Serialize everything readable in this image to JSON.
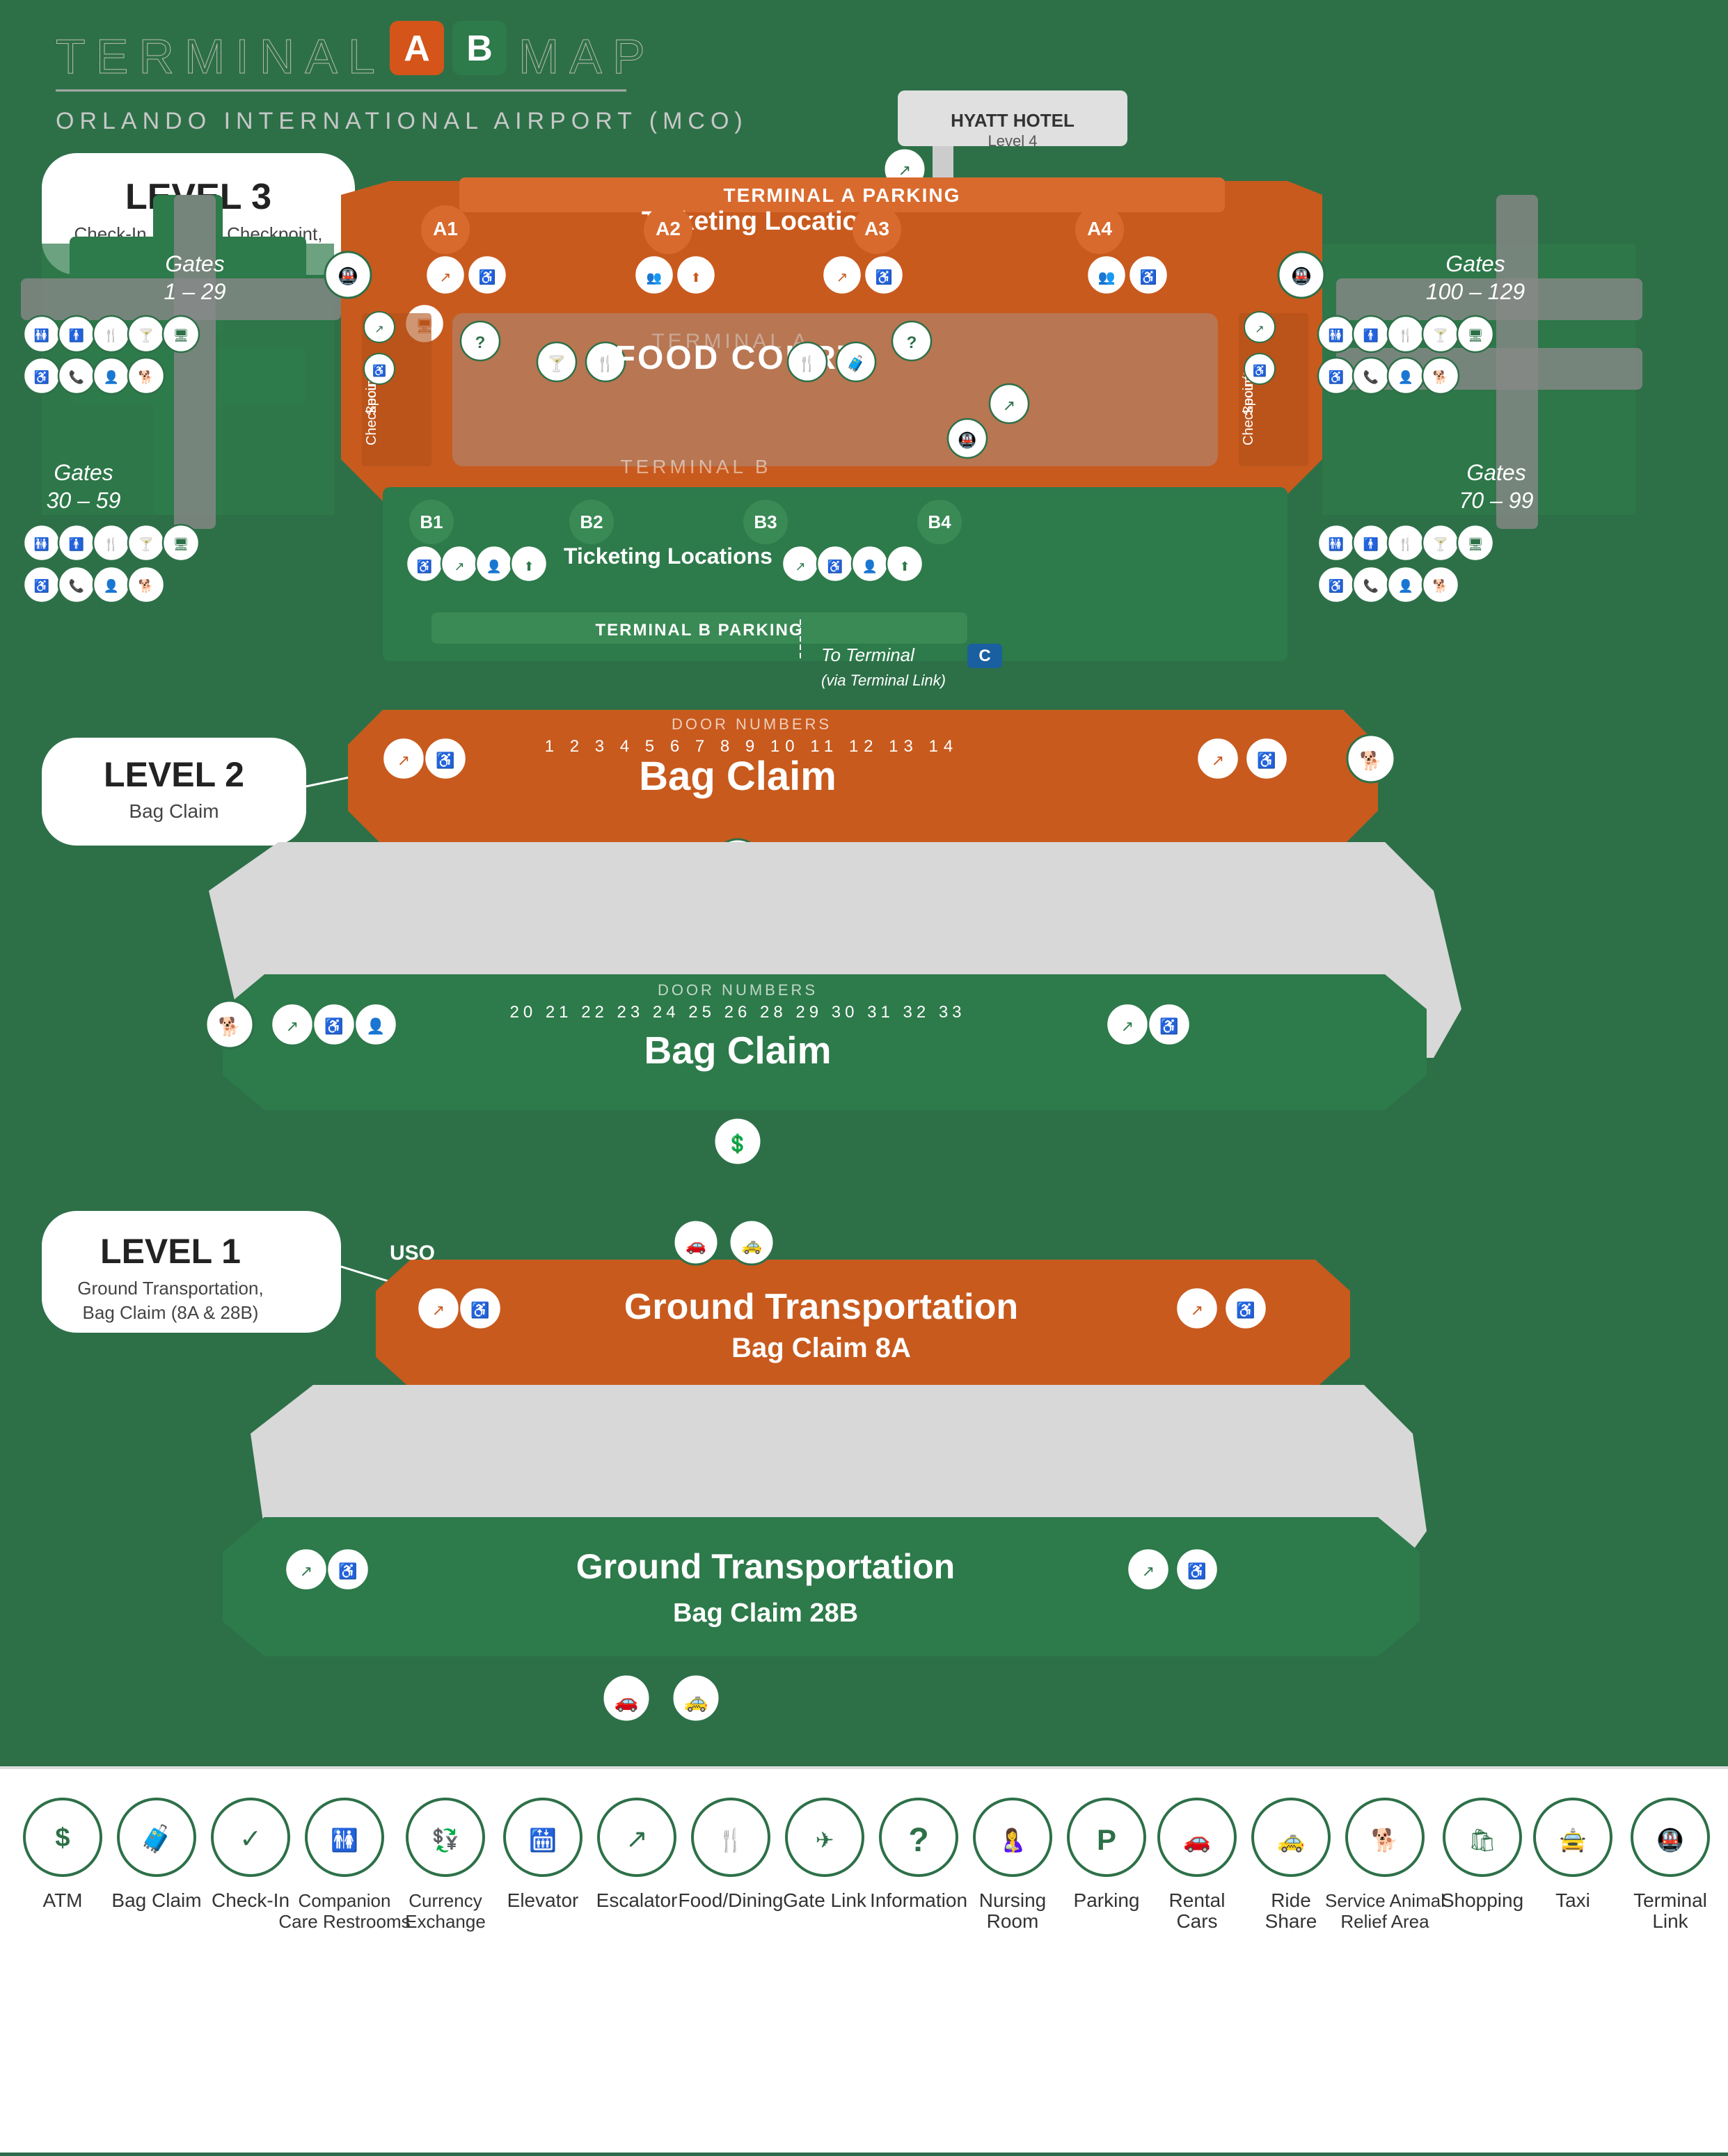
{
  "title": {
    "prefix": "TERMINAL",
    "badge_a": "A",
    "badge_b": "B",
    "suffix": "MAP",
    "airport": "ORLANDO INTERNATIONAL AIRPORT (MCO)"
  },
  "levels": {
    "level3": {
      "number": "LEVEL 3",
      "description": "Check-In, Security Checkpoint,\nGates"
    },
    "level2": {
      "number": "LEVEL 2",
      "description": "Bag Claim"
    },
    "level1": {
      "number": "LEVEL 1",
      "description": "Ground Transportation,\nBag Claim (8A & 28B)"
    }
  },
  "terminal_a": {
    "label": "TERMINAL A",
    "parking": "TERMINAL A PARKING",
    "ticketing": "Ticketing Locations",
    "food_court": "FOOD COURT",
    "gates": {
      "left": "Gates\n1 – 29",
      "right": "Gates\n100 – 129"
    }
  },
  "terminal_b": {
    "label": "TERMINAL B",
    "parking": "TERMINAL B PARKING",
    "ticketing": "Ticketing Locations",
    "gates": {
      "left": "Gates\n30 – 59",
      "right": "Gates\n70 – 99"
    }
  },
  "terminal_c": {
    "label": "To Terminal C\n(via Terminal Link)"
  },
  "bag_claim": {
    "top_label": "Bag Claim",
    "door_numbers_top": "DOOR NUMBERS",
    "doors_top": "1  2  3  4  5  6  7  8  9  10   11   12   13   14",
    "bottom_label": "Bag Claim",
    "door_numbers_bottom": "DOOR NUMBERS",
    "doors_bottom": "20  21  22  23  24  25  26  28  29  30  31  32  33"
  },
  "ground_transport": {
    "top": "Ground Transportation\nBag Claim 8A",
    "bottom": "Ground Transportation\nBag Claim 28B",
    "uso": "USO"
  },
  "hyatt": {
    "label": "HYATT HOTEL\nLevel 4"
  },
  "legend": {
    "items": [
      {
        "id": "atm",
        "icon": "💲",
        "label": "ATM"
      },
      {
        "id": "bag-claim",
        "icon": "🧳",
        "label": "Bag Claim"
      },
      {
        "id": "check-in",
        "icon": "✔",
        "label": "Check-In"
      },
      {
        "id": "companion-restrooms",
        "icon": "🚻",
        "label": "Companion Care Restrooms"
      },
      {
        "id": "currency-exchange",
        "icon": "💱",
        "label": "Currency Exchange"
      },
      {
        "id": "elevator",
        "icon": "🛗",
        "label": "Elevator"
      },
      {
        "id": "escalator",
        "icon": "↗",
        "label": "Escalator"
      },
      {
        "id": "food-dining",
        "icon": "🍴",
        "label": "Food/Dining"
      },
      {
        "id": "gate-link",
        "icon": "🔗",
        "label": "Gate Link"
      },
      {
        "id": "information",
        "icon": "ℹ",
        "label": "Information"
      },
      {
        "id": "nursing-room",
        "icon": "🤱",
        "label": "Nursing Room"
      },
      {
        "id": "parking",
        "icon": "P",
        "label": "Parking"
      },
      {
        "id": "rental-cars",
        "icon": "🚗",
        "label": "Rental Cars"
      },
      {
        "id": "ride-share",
        "icon": "🚕",
        "label": "Ride Share"
      },
      {
        "id": "service-animal",
        "icon": "🐕",
        "label": "Service Animal Relief Area"
      },
      {
        "id": "shopping",
        "icon": "🛍",
        "label": "Shopping"
      },
      {
        "id": "taxi",
        "icon": "🚖",
        "label": "Taxi"
      },
      {
        "id": "terminal-link",
        "icon": "🚇",
        "label": "Terminal Link"
      }
    ]
  }
}
